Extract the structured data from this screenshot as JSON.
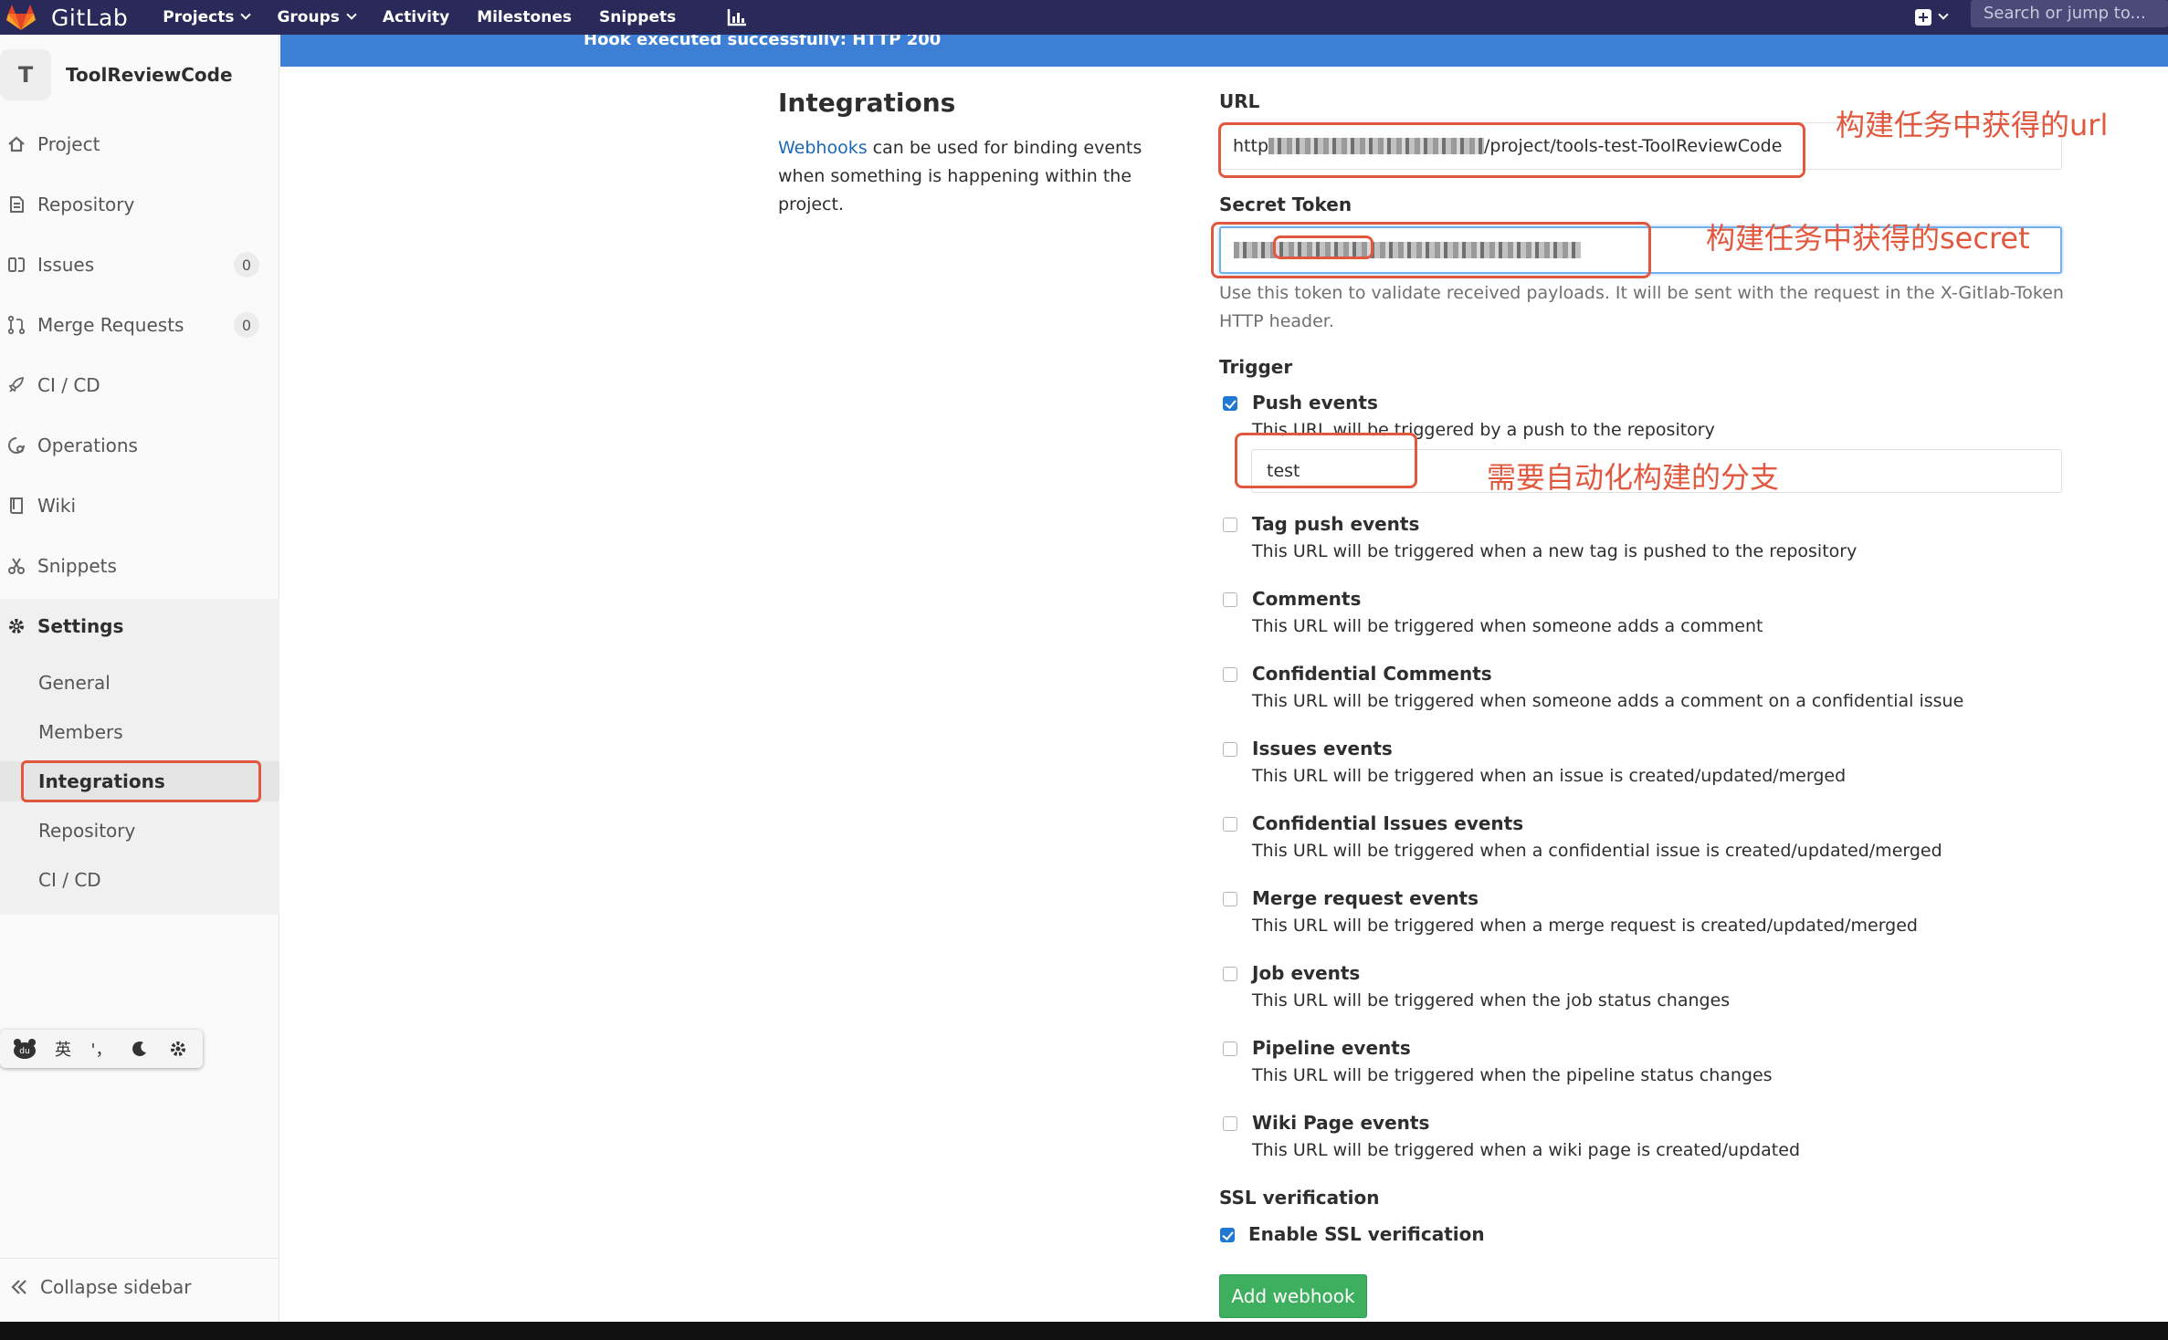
{
  "navbar": {
    "brand": "GitLab",
    "links": [
      {
        "label": "Projects",
        "dropdown": true
      },
      {
        "label": "Groups",
        "dropdown": true
      },
      {
        "label": "Activity",
        "dropdown": false
      },
      {
        "label": "Milestones",
        "dropdown": false
      },
      {
        "label": "Snippets",
        "dropdown": false
      }
    ],
    "search_placeholder": "Search or jump to..."
  },
  "flash": {
    "message": "Hook executed successfully: HTTP 200"
  },
  "sidebar": {
    "avatar_letter": "T",
    "project_name": "ToolReviewCode",
    "items": [
      {
        "label": "Project",
        "icon": "home-icon"
      },
      {
        "label": "Repository",
        "icon": "doc-icon"
      },
      {
        "label": "Issues",
        "icon": "issues-icon",
        "badge": "0"
      },
      {
        "label": "Merge Requests",
        "icon": "merge-icon",
        "badge": "0"
      },
      {
        "label": "CI / CD",
        "icon": "rocket-icon"
      },
      {
        "label": "Operations",
        "icon": "operations-icon"
      },
      {
        "label": "Wiki",
        "icon": "book-icon"
      },
      {
        "label": "Snippets",
        "icon": "scissors-icon"
      },
      {
        "label": "Settings",
        "icon": "gear-icon"
      }
    ],
    "settings_sub": [
      "General",
      "Members",
      "Integrations",
      "Repository",
      "CI / CD"
    ],
    "collapse_label": "Collapse sidebar",
    "ime": {
      "lang": "英",
      "punct": "'，",
      "icons": [
        "bear-icon",
        "moon-icon",
        "gear-icon"
      ]
    }
  },
  "content": {
    "title": "Integrations",
    "desc_link": "Webhooks",
    "desc_rest": " can be used for binding events when something is happening within the project.",
    "url_label": "URL",
    "url_prefix": "http",
    "url_suffix": "/project/tools-test-ToolReviewCode",
    "secret_label": "Secret Token",
    "secret_help": "Use this token to validate received payloads. It will be sent with the request in the X-Gitlab-Token HTTP header.",
    "trigger_label": "Trigger",
    "triggers": [
      {
        "title": "Push events",
        "desc": "This URL will be triggered by a push to the repository",
        "checked": true
      },
      {
        "title": "Tag push events",
        "desc": "This URL will be triggered when a new tag is pushed to the repository",
        "checked": false
      },
      {
        "title": "Comments",
        "desc": "This URL will be triggered when someone adds a comment",
        "checked": false
      },
      {
        "title": "Confidential Comments",
        "desc": "This URL will be triggered when someone adds a comment on a confidential issue",
        "checked": false
      },
      {
        "title": "Issues events",
        "desc": "This URL will be triggered when an issue is created/updated/merged",
        "checked": false
      },
      {
        "title": "Confidential Issues events",
        "desc": "This URL will be triggered when a confidential issue is created/updated/merged",
        "checked": false
      },
      {
        "title": "Merge request events",
        "desc": "This URL will be triggered when a merge request is created/updated/merged",
        "checked": false
      },
      {
        "title": "Job events",
        "desc": "This URL will be triggered when the job status changes",
        "checked": false
      },
      {
        "title": "Pipeline events",
        "desc": "This URL will be triggered when the pipeline status changes",
        "checked": false
      },
      {
        "title": "Wiki Page events",
        "desc": "This URL will be triggered when a wiki page is created/updated",
        "checked": false
      }
    ],
    "branch_value": "test",
    "ssl_label": "SSL verification",
    "ssl_option": "Enable SSL verification",
    "ssl_checked": true,
    "add_button": "Add webhook"
  },
  "annotations": {
    "url_note": "构建任务中获得的url",
    "secret_note": "构建任务中获得的secret",
    "branch_note": "需要自动化构建的分支",
    "color": "#e2583e"
  },
  "colors": {
    "navbar": "#29295a",
    "flash": "#3e7fd6",
    "link": "#1b69b6",
    "button": "#3eaf5e",
    "checkbox": "#1f78d1"
  }
}
